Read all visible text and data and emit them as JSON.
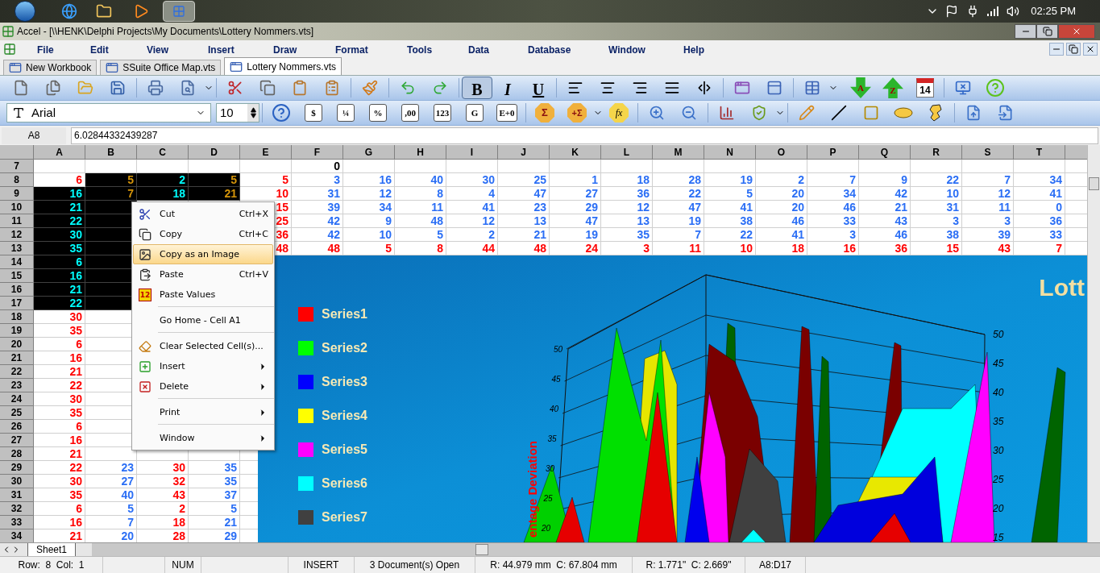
{
  "taskbar": {
    "clock": "02:25 PM"
  },
  "window": {
    "title": "Accel - [\\\\HENK\\Delphi Projects\\My Documents\\Lottery Nommers.vts]"
  },
  "menu": [
    "File",
    "Edit",
    "View",
    "Insert",
    "Draw",
    "Format",
    "Tools",
    "Data",
    "Database",
    "Window",
    "Help"
  ],
  "document_tabs": [
    {
      "label": "New Workbook",
      "selected": false
    },
    {
      "label": "SSuite Office Map.vts",
      "selected": false
    },
    {
      "label": "Lottery Nommers.vts",
      "selected": true
    }
  ],
  "toolbar": {
    "bold": {
      "label": "B",
      "on": true
    },
    "italic": {
      "label": "I",
      "on": false
    },
    "underline": {
      "label": "U",
      "on": false
    },
    "sort_ascending": "A",
    "sort_descending": "Z",
    "calendar_day": "14"
  },
  "format_toolbar": {
    "font": "Arial",
    "size": "10",
    "buttons": [
      "$",
      "¼",
      "%",
      ",00",
      "123",
      "G",
      "E+0"
    ],
    "autosum": "Σ",
    "autosum_plus": "+Σ",
    "function": "fx"
  },
  "formula_bar": {
    "cell": "A8",
    "value": "6.02844332439287"
  },
  "grid": {
    "columns": [
      "A",
      "B",
      "C",
      "D",
      "E",
      "F",
      "G",
      "H",
      "I",
      "J",
      "K",
      "L",
      "M",
      "N",
      "O",
      "P",
      "Q",
      "R",
      "S",
      "T"
    ],
    "rows": [
      {
        "label": "7",
        "cells": [
          null,
          null,
          null,
          null,
          null,
          {
            "value": "0",
            "color": "#000000",
            "selected": false
          }
        ]
      },
      {
        "label": "8",
        "cells": [
          {
            "value": "6",
            "color": "#ff0000",
            "selected": false
          },
          {
            "value": "5",
            "color": "#d4940a",
            "selected": true
          },
          {
            "value": "2",
            "color": "#00ffff",
            "selected": true
          },
          {
            "value": "5",
            "color": "#d4940a",
            "selected": true
          },
          {
            "value": "5",
            "color": "#ff0000",
            "selected": false
          },
          {
            "value": "3",
            "color": "#2a6ef5",
            "selected": false
          },
          {
            "value": "16",
            "color": "#2a6ef5",
            "selected": false
          },
          {
            "value": "40",
            "color": "#2a6ef5",
            "selected": false
          },
          {
            "value": "30",
            "color": "#2a6ef5",
            "selected": false
          },
          {
            "value": "25",
            "color": "#2a6ef5",
            "selected": false
          },
          {
            "value": "1",
            "color": "#2a6ef5",
            "selected": false
          },
          {
            "value": "18",
            "color": "#2a6ef5",
            "selected": false
          },
          {
            "value": "28",
            "color": "#2a6ef5",
            "selected": false
          },
          {
            "value": "19",
            "color": "#2a6ef5",
            "selected": false
          },
          {
            "value": "2",
            "color": "#2a6ef5",
            "selected": false
          },
          {
            "value": "7",
            "color": "#2a6ef5",
            "selected": false
          },
          {
            "value": "9",
            "color": "#2a6ef5",
            "selected": false
          },
          {
            "value": "22",
            "color": "#2a6ef5",
            "selected": false
          },
          {
            "value": "7",
            "color": "#2a6ef5",
            "selected": false
          },
          {
            "value": "34",
            "color": "#2a6ef5",
            "selected": false
          }
        ]
      },
      {
        "label": "9",
        "cells": [
          {
            "value": "16",
            "color": "#00ffff",
            "selected": true
          },
          {
            "value": "7",
            "color": "#d4940a",
            "selected": true
          },
          {
            "value": "18",
            "color": "#00ffff",
            "selected": true
          },
          {
            "value": "21",
            "color": "#d4940a",
            "selected": true
          },
          {
            "value": "10",
            "color": "#ff0000",
            "selected": false
          },
          {
            "value": "31",
            "color": "#2a6ef5",
            "selected": false
          },
          {
            "value": "12",
            "color": "#2a6ef5",
            "selected": false
          },
          {
            "value": "8",
            "color": "#2a6ef5",
            "selected": false
          },
          {
            "value": "4",
            "color": "#2a6ef5",
            "selected": false
          },
          {
            "value": "47",
            "color": "#2a6ef5",
            "selected": false
          },
          {
            "value": "27",
            "color": "#2a6ef5",
            "selected": false
          },
          {
            "value": "36",
            "color": "#2a6ef5",
            "selected": false
          },
          {
            "value": "22",
            "color": "#2a6ef5",
            "selected": false
          },
          {
            "value": "5",
            "color": "#2a6ef5",
            "selected": false
          },
          {
            "value": "20",
            "color": "#2a6ef5",
            "selected": false
          },
          {
            "value": "34",
            "color": "#2a6ef5",
            "selected": false
          },
          {
            "value": "42",
            "color": "#2a6ef5",
            "selected": false
          },
          {
            "value": "10",
            "color": "#2a6ef5",
            "selected": false
          },
          {
            "value": "12",
            "color": "#2a6ef5",
            "selected": false
          },
          {
            "value": "41",
            "color": "#2a6ef5",
            "selected": false
          }
        ]
      },
      {
        "label": "10",
        "cells": [
          {
            "value": "21",
            "color": "#00ffff",
            "selected": true
          },
          {
            "selected": true
          },
          null,
          null,
          {
            "value": "15",
            "color": "#ff0000",
            "selected": false
          },
          {
            "value": "39",
            "color": "#2a6ef5",
            "selected": false
          },
          {
            "value": "34",
            "color": "#2a6ef5",
            "selected": false
          },
          {
            "value": "11",
            "color": "#2a6ef5",
            "selected": false
          },
          {
            "value": "41",
            "color": "#2a6ef5",
            "selected": false
          },
          {
            "value": "23",
            "color": "#2a6ef5",
            "selected": false
          },
          {
            "value": "29",
            "color": "#2a6ef5",
            "selected": false
          },
          {
            "value": "12",
            "color": "#2a6ef5",
            "selected": false
          },
          {
            "value": "47",
            "color": "#2a6ef5",
            "selected": false
          },
          {
            "value": "41",
            "color": "#2a6ef5",
            "selected": false
          },
          {
            "value": "20",
            "color": "#2a6ef5",
            "selected": false
          },
          {
            "value": "46",
            "color": "#2a6ef5",
            "selected": false
          },
          {
            "value": "21",
            "color": "#2a6ef5",
            "selected": false
          },
          {
            "value": "31",
            "color": "#2a6ef5",
            "selected": false
          },
          {
            "value": "11",
            "color": "#2a6ef5",
            "selected": false
          },
          {
            "value": "0",
            "color": "#2a6ef5",
            "selected": false
          }
        ]
      },
      {
        "label": "11",
        "cells": [
          {
            "value": "22",
            "color": "#00ffff",
            "selected": true
          },
          {
            "selected": true
          },
          null,
          null,
          {
            "value": "25",
            "color": "#ff0000",
            "selected": false
          },
          {
            "value": "42",
            "color": "#2a6ef5",
            "selected": false
          },
          {
            "value": "9",
            "color": "#2a6ef5",
            "selected": false
          },
          {
            "value": "48",
            "color": "#2a6ef5",
            "selected": false
          },
          {
            "value": "12",
            "color": "#2a6ef5",
            "selected": false
          },
          {
            "value": "13",
            "color": "#2a6ef5",
            "selected": false
          },
          {
            "value": "47",
            "color": "#2a6ef5",
            "selected": false
          },
          {
            "value": "13",
            "color": "#2a6ef5",
            "selected": false
          },
          {
            "value": "19",
            "color": "#2a6ef5",
            "selected": false
          },
          {
            "value": "38",
            "color": "#2a6ef5",
            "selected": false
          },
          {
            "value": "46",
            "color": "#2a6ef5",
            "selected": false
          },
          {
            "value": "33",
            "color": "#2a6ef5",
            "selected": false
          },
          {
            "value": "43",
            "color": "#2a6ef5",
            "selected": false
          },
          {
            "value": "3",
            "color": "#2a6ef5",
            "selected": false
          },
          {
            "value": "3",
            "color": "#2a6ef5",
            "selected": false
          },
          {
            "value": "36",
            "color": "#2a6ef5",
            "selected": false
          }
        ]
      },
      {
        "label": "12",
        "cells": [
          {
            "value": "30",
            "color": "#00ffff",
            "selected": true
          },
          {
            "selected": true
          },
          null,
          null,
          {
            "value": "36",
            "color": "#ff0000",
            "selected": false
          },
          {
            "value": "42",
            "color": "#2a6ef5",
            "selected": false
          },
          {
            "value": "10",
            "color": "#2a6ef5",
            "selected": false
          },
          {
            "value": "5",
            "color": "#2a6ef5",
            "selected": false
          },
          {
            "value": "2",
            "color": "#2a6ef5",
            "selected": false
          },
          {
            "value": "21",
            "color": "#2a6ef5",
            "selected": false
          },
          {
            "value": "19",
            "color": "#2a6ef5",
            "selected": false
          },
          {
            "value": "35",
            "color": "#2a6ef5",
            "selected": false
          },
          {
            "value": "7",
            "color": "#2a6ef5",
            "selected": false
          },
          {
            "value": "22",
            "color": "#2a6ef5",
            "selected": false
          },
          {
            "value": "41",
            "color": "#2a6ef5",
            "selected": false
          },
          {
            "value": "3",
            "color": "#2a6ef5",
            "selected": false
          },
          {
            "value": "46",
            "color": "#2a6ef5",
            "selected": false
          },
          {
            "value": "38",
            "color": "#2a6ef5",
            "selected": false
          },
          {
            "value": "39",
            "color": "#2a6ef5",
            "selected": false
          },
          {
            "value": "33",
            "color": "#2a6ef5",
            "selected": false
          }
        ]
      },
      {
        "label": "13",
        "cells": [
          {
            "value": "35",
            "color": "#00ffff",
            "selected": true
          },
          {
            "selected": true
          },
          null,
          null,
          {
            "value": "48",
            "color": "#ff0000",
            "selected": false
          },
          {
            "value": "48",
            "color": "#ff0000",
            "selected": false
          },
          {
            "value": "5",
            "color": "#ff0000",
            "selected": false
          },
          {
            "value": "8",
            "color": "#ff0000",
            "selected": false
          },
          {
            "value": "44",
            "color": "#ff0000",
            "selected": false
          },
          {
            "value": "48",
            "color": "#ff0000",
            "selected": false
          },
          {
            "value": "24",
            "color": "#ff0000",
            "selected": false
          },
          {
            "value": "3",
            "color": "#ff0000",
            "selected": false
          },
          {
            "value": "11",
            "color": "#ff0000",
            "selected": false
          },
          {
            "value": "10",
            "color": "#ff0000",
            "selected": false
          },
          {
            "value": "18",
            "color": "#ff0000",
            "selected": false
          },
          {
            "value": "16",
            "color": "#ff0000",
            "selected": false
          },
          {
            "value": "36",
            "color": "#ff0000",
            "selected": false
          },
          {
            "value": "15",
            "color": "#ff0000",
            "selected": false
          },
          {
            "value": "43",
            "color": "#ff0000",
            "selected": false
          },
          {
            "value": "7",
            "color": "#ff0000",
            "selected": false
          }
        ]
      },
      {
        "label": "14",
        "cells": [
          {
            "value": "6",
            "color": "#00ffff",
            "selected": true
          },
          {
            "selected": true
          }
        ]
      },
      {
        "label": "15",
        "cells": [
          {
            "value": "16",
            "color": "#00ffff",
            "selected": true
          },
          {
            "selected": true
          }
        ]
      },
      {
        "label": "16",
        "cells": [
          {
            "value": "21",
            "color": "#00ffff",
            "selected": true
          },
          {
            "selected": true
          }
        ]
      },
      {
        "label": "17",
        "cells": [
          {
            "value": "22",
            "color": "#00ffff",
            "selected": true
          },
          {
            "selected": true
          }
        ]
      },
      {
        "label": "18",
        "cells": [
          {
            "value": "30",
            "color": "#ff0000",
            "selected": false
          }
        ]
      },
      {
        "label": "19",
        "cells": [
          {
            "value": "35",
            "color": "#ff0000",
            "selected": false
          }
        ]
      },
      {
        "label": "20",
        "cells": [
          {
            "value": "6",
            "color": "#ff0000",
            "selected": false
          }
        ]
      },
      {
        "label": "21",
        "cells": [
          {
            "value": "16",
            "color": "#ff0000",
            "selected": false
          }
        ]
      },
      {
        "label": "22",
        "cells": [
          {
            "value": "21",
            "color": "#ff0000",
            "selected": false
          }
        ]
      },
      {
        "label": "23",
        "cells": [
          {
            "value": "22",
            "color": "#ff0000",
            "selected": false
          }
        ]
      },
      {
        "label": "24",
        "cells": [
          {
            "value": "30",
            "color": "#ff0000",
            "selected": false
          }
        ]
      },
      {
        "label": "25",
        "cells": [
          {
            "value": "35",
            "color": "#ff0000",
            "selected": false
          }
        ]
      },
      {
        "label": "26",
        "cells": [
          {
            "value": "6",
            "color": "#ff0000",
            "selected": false
          }
        ]
      },
      {
        "label": "27",
        "cells": [
          {
            "value": "16",
            "color": "#ff0000",
            "selected": false
          }
        ]
      },
      {
        "label": "28",
        "cells": [
          {
            "value": "21",
            "color": "#ff0000",
            "selected": false
          }
        ]
      },
      {
        "label": "29",
        "cells": [
          {
            "value": "22",
            "color": "#ff0000",
            "selected": false
          },
          {
            "value": "23",
            "color": "#2a6ef5",
            "selected": false
          },
          {
            "value": "30",
            "color": "#ff0000",
            "selected": false
          },
          {
            "value": "35",
            "color": "#2a6ef5",
            "selected": false
          }
        ]
      },
      {
        "label": "30",
        "cells": [
          {
            "value": "30",
            "color": "#ff0000",
            "selected": false
          },
          {
            "value": "27",
            "color": "#2a6ef5",
            "selected": false
          },
          {
            "value": "32",
            "color": "#ff0000",
            "selected": false
          },
          {
            "value": "35",
            "color": "#2a6ef5",
            "selected": false
          }
        ]
      },
      {
        "label": "31",
        "cells": [
          {
            "value": "35",
            "color": "#ff0000",
            "selected": false
          },
          {
            "value": "40",
            "color": "#2a6ef5",
            "selected": false
          },
          {
            "value": "43",
            "color": "#ff0000",
            "selected": false
          },
          {
            "value": "37",
            "color": "#2a6ef5",
            "selected": false
          }
        ]
      },
      {
        "label": "32",
        "cells": [
          {
            "value": "6",
            "color": "#ff0000",
            "selected": false
          },
          {
            "value": "5",
            "color": "#2a6ef5",
            "selected": false
          },
          {
            "value": "2",
            "color": "#ff0000",
            "selected": false
          },
          {
            "value": "5",
            "color": "#2a6ef5",
            "selected": false
          }
        ]
      },
      {
        "label": "33",
        "cells": [
          {
            "value": "16",
            "color": "#ff0000",
            "selected": false
          },
          {
            "value": "7",
            "color": "#2a6ef5",
            "selected": false
          },
          {
            "value": "18",
            "color": "#ff0000",
            "selected": false
          },
          {
            "value": "21",
            "color": "#2a6ef5",
            "selected": false
          }
        ]
      },
      {
        "label": "34",
        "cells": [
          {
            "value": "21",
            "color": "#ff0000",
            "selected": false
          },
          {
            "value": "20",
            "color": "#2a6ef5",
            "selected": false
          },
          {
            "value": "28",
            "color": "#ff0000",
            "selected": false
          },
          {
            "value": "29",
            "color": "#2a6ef5",
            "selected": false
          }
        ]
      }
    ]
  },
  "chart": {
    "title": "Lott",
    "axis_title": "entage Deviation",
    "legend": [
      {
        "name": "Series1",
        "color": "#ff0000"
      },
      {
        "name": "Series2",
        "color": "#00ff00"
      },
      {
        "name": "Series3",
        "color": "#0000ff"
      },
      {
        "name": "Series4",
        "color": "#ffff00"
      },
      {
        "name": "Series5",
        "color": "#ff00ff"
      },
      {
        "name": "Series6",
        "color": "#00ffff"
      },
      {
        "name": "Series7",
        "color": "#404040"
      }
    ],
    "left_ticks": [
      "50",
      "45",
      "40",
      "35",
      "30",
      "25",
      "20"
    ],
    "right_ticks": [
      "50",
      "45",
      "40",
      "35",
      "30",
      "25",
      "20",
      "15"
    ]
  },
  "context_menu": [
    {
      "kind": "item",
      "label": "Cut",
      "shortcut": "Ctrl+X",
      "selected": false,
      "submenu": false
    },
    {
      "kind": "item",
      "label": "Copy",
      "shortcut": "Ctrl+C",
      "selected": false,
      "submenu": false
    },
    {
      "kind": "item",
      "label": "Copy as an Image",
      "selected": true,
      "submenu": false
    },
    {
      "kind": "item",
      "label": "Paste",
      "shortcut": "Ctrl+V",
      "selected": false,
      "submenu": false
    },
    {
      "kind": "item",
      "label": "Paste Values",
      "icon_label": "12",
      "selected": false,
      "submenu": false
    },
    {
      "kind": "separator"
    },
    {
      "kind": "item",
      "label": "Go Home - Cell A1",
      "selected": false,
      "submenu": false
    },
    {
      "kind": "separator"
    },
    {
      "kind": "item",
      "label": "Clear Selected Cell(s)...",
      "selected": false,
      "submenu": false
    },
    {
      "kind": "item",
      "label": "Insert",
      "selected": false,
      "submenu": true
    },
    {
      "kind": "item",
      "label": "Delete",
      "selected": false,
      "submenu": true
    },
    {
      "kind": "separator"
    },
    {
      "kind": "item",
      "label": "Print",
      "selected": false,
      "submenu": true
    },
    {
      "kind": "separator"
    },
    {
      "kind": "item",
      "label": "Window",
      "selected": false,
      "submenu": true
    }
  ],
  "sheet_tabs": [
    {
      "label": "Sheet1",
      "selected": true
    }
  ],
  "status_bar": [
    "Row:  8  Col:  1",
    "NUM",
    "INSERT",
    "3 Document(s) Open",
    "R: 44.979 mm  C: 67.804 mm",
    "R: 1.771\"  C: 2.669\"",
    "A8:D17"
  ]
}
